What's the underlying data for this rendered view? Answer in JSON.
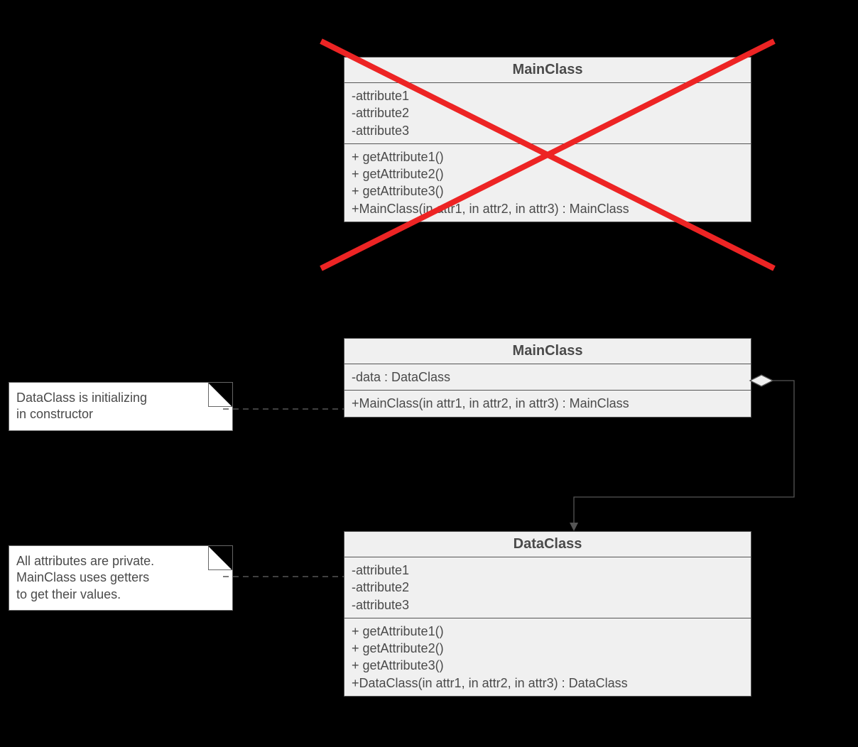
{
  "classes": {
    "bad": {
      "title": "MainClass",
      "attrs": "-attribute1\n-attribute2\n-attribute3",
      "ops": "+ getAttribute1()\n+ getAttribute2()\n+ getAttribute3()\n+MainClass(in attr1, in attr2, in attr3) : MainClass"
    },
    "main": {
      "title": "MainClass",
      "attrs": "-data : DataClass",
      "ops": "+MainClass(in attr1, in attr2, in attr3) : MainClass"
    },
    "data": {
      "title": "DataClass",
      "attrs": "-attribute1\n-attribute2\n-attribute3",
      "ops": "+ getAttribute1()\n+ getAttribute2()\n+ getAttribute3()\n+DataClass(in attr1, in attr2, in attr3) : DataClass"
    }
  },
  "notes": {
    "n1": "DataClass is initializing\nin constructor",
    "n2": "All attributes are private.\nMainClass uses getters\nto get their values."
  }
}
